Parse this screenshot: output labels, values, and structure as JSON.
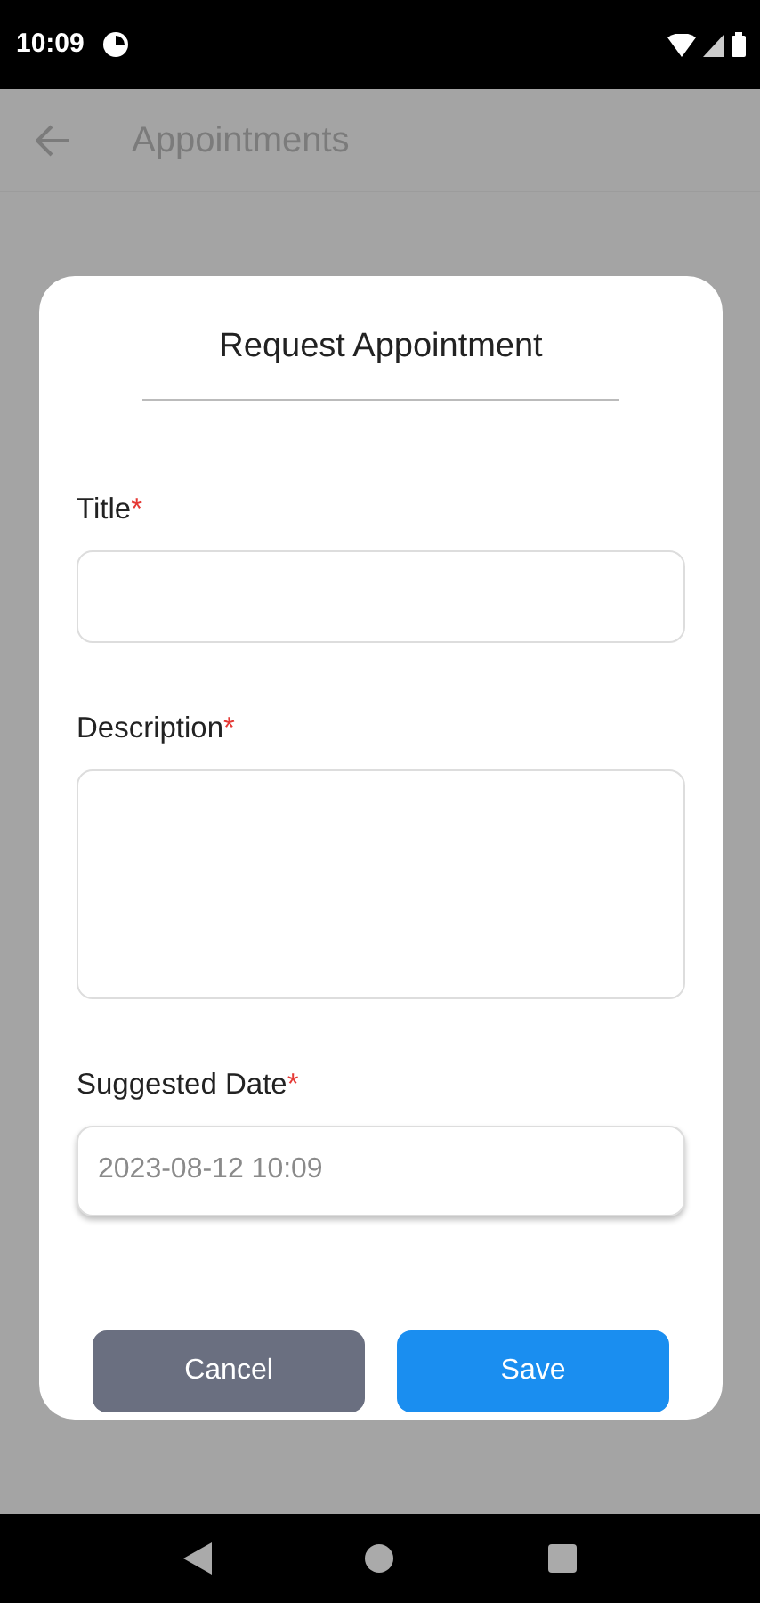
{
  "status_bar": {
    "time": "10:09"
  },
  "app_bar": {
    "title": "Appointments"
  },
  "dialog": {
    "title": "Request Appointment",
    "fields": [
      {
        "kind": "text",
        "label": "Title",
        "required_mark": "*"
      },
      {
        "kind": "textarea",
        "label": "Description",
        "required_mark": "*"
      },
      {
        "kind": "date",
        "label": "Suggested Date",
        "required_mark": "*",
        "value": "2023-08-12 10:09"
      }
    ],
    "buttons": [
      {
        "kind": "secondary",
        "label": "Cancel"
      },
      {
        "kind": "primary",
        "label": "Save"
      }
    ]
  }
}
